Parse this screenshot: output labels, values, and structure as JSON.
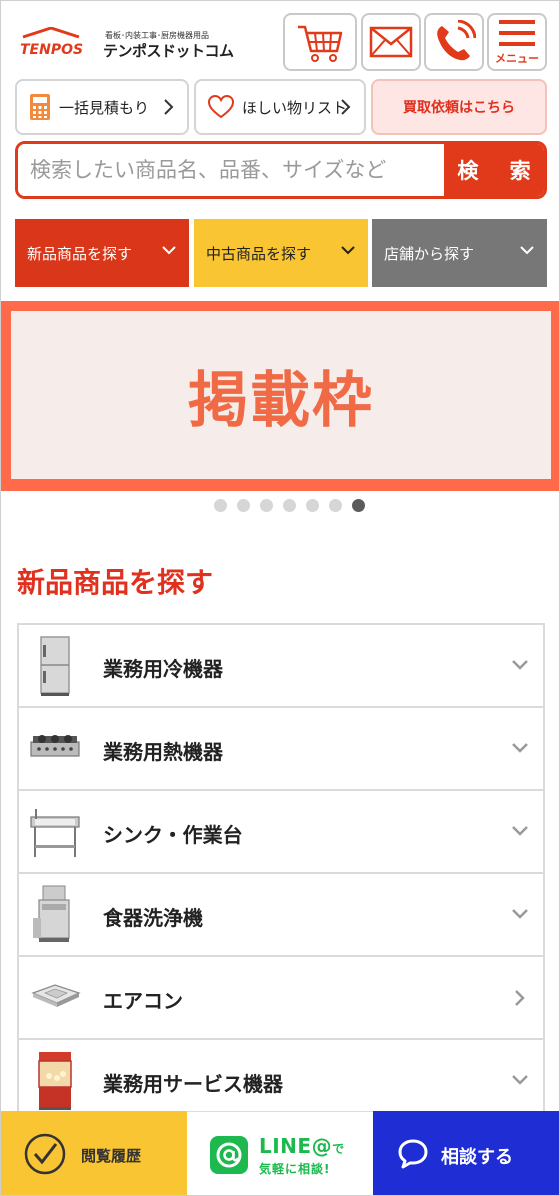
{
  "header": {
    "logo_mark": "TENPOS",
    "logo_tagline": "看板･内装工事･厨房機器用品",
    "logo_name": "テンポスドットコム",
    "cart_icon": "cart-icon",
    "mail_icon": "mail-icon",
    "phone_icon": "phone-icon",
    "menu_label": "メニュー",
    "accent_color": "#e03a1a"
  },
  "quick": {
    "estimate_label": "一括見積もり",
    "wishlist_label": "ほしい物リスト",
    "buyback_label": "買取依頼はこちら"
  },
  "search": {
    "placeholder": "検索したい商品名、品番、サイズなど",
    "button_label": "検 索"
  },
  "categories": {
    "new_label": "新品商品を探す",
    "used_label": "中古商品を探す",
    "store_label": "店舗から探す"
  },
  "banner": {
    "text": "掲載枠",
    "slide_count": 7,
    "active_slide": 7
  },
  "section": {
    "title": "新品商品を探す",
    "items": [
      {
        "label": "業務用冷機器",
        "icon": "refrigerator-icon",
        "chevron": "down"
      },
      {
        "label": "業務用熱機器",
        "icon": "gas-range-icon",
        "chevron": "down"
      },
      {
        "label": "シンク・作業台",
        "icon": "sink-icon",
        "chevron": "down"
      },
      {
        "label": "食器洗浄機",
        "icon": "dishwasher-icon",
        "chevron": "down"
      },
      {
        "label": "エアコン",
        "icon": "air-conditioner-icon",
        "chevron": "right"
      },
      {
        "label": "業務用サービス機器",
        "icon": "popcorn-machine-icon",
        "chevron": "down"
      }
    ]
  },
  "bottom": {
    "history_label": "閲覧履歴",
    "line_main": "LINE@",
    "line_de": "で",
    "line_sub": "気軽に相談!",
    "consult_label": "相談する"
  }
}
